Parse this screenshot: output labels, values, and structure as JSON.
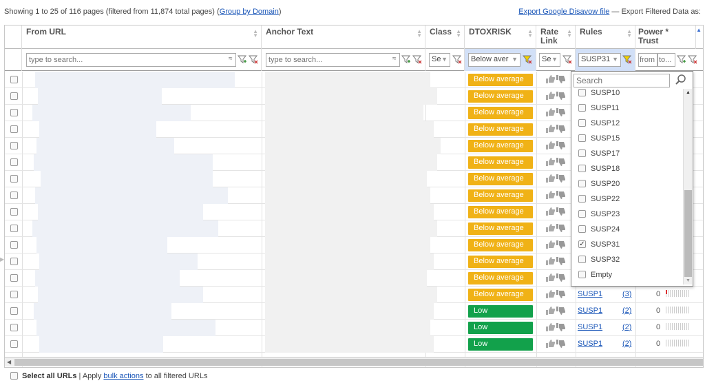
{
  "top": {
    "showing_text": "Showing 1 to 25 of 116 pages (filtered from 11,874 total pages) (",
    "group_link": "Group by Domain",
    "showing_close": ")",
    "export_link": "Export Google Disavow file",
    "export_text": " — Export Filtered Data as:"
  },
  "columns": {
    "from_url": "From URL",
    "anchor_text": "Anchor Text",
    "class": "Class",
    "dtoxrisk": "DTOXRISK",
    "rate_link": "Rate Link",
    "rules": "Rules",
    "power_trust": "Power * Trust"
  },
  "filters": {
    "from_url_placeholder": "type to search...",
    "anchor_placeholder": "type to search...",
    "class_value": "Se",
    "dtox_value": "Below aver",
    "rate_value": "Se",
    "rules_value": "SUSP31",
    "power_from": "from",
    "power_to": "to..."
  },
  "rows": [
    {
      "risk": "Below average",
      "level": "below",
      "rule": "",
      "count": "",
      "power": ""
    },
    {
      "risk": "Below average",
      "level": "below",
      "rule": "",
      "count": "",
      "power": ""
    },
    {
      "risk": "Below average",
      "level": "below",
      "rule": "",
      "count": "",
      "power": ""
    },
    {
      "risk": "Below average",
      "level": "below",
      "rule": "",
      "count": "",
      "power": ""
    },
    {
      "risk": "Below average",
      "level": "below",
      "rule": "",
      "count": "",
      "power": ""
    },
    {
      "risk": "Below average",
      "level": "below",
      "rule": "",
      "count": "",
      "power": ""
    },
    {
      "risk": "Below average",
      "level": "below",
      "rule": "",
      "count": "",
      "power": ""
    },
    {
      "risk": "Below average",
      "level": "below",
      "rule": "",
      "count": "",
      "power": ""
    },
    {
      "risk": "Below average",
      "level": "below",
      "rule": "",
      "count": "",
      "power": ""
    },
    {
      "risk": "Below average",
      "level": "below",
      "rule": "",
      "count": "",
      "power": ""
    },
    {
      "risk": "Below average",
      "level": "below",
      "rule": "",
      "count": "",
      "power": ""
    },
    {
      "risk": "Below average",
      "level": "below",
      "rule": "",
      "count": "",
      "power": ""
    },
    {
      "risk": "Below average",
      "level": "below",
      "rule": "",
      "count": "",
      "power": ""
    },
    {
      "risk": "Below average",
      "level": "below",
      "rule": "SUSP1",
      "count": "(3)",
      "power": "0"
    },
    {
      "risk": "Low",
      "level": "low",
      "rule": "SUSP1",
      "count": "(2)",
      "power": "0"
    },
    {
      "risk": "Low",
      "level": "low",
      "rule": "SUSP1",
      "count": "(2)",
      "power": "0"
    },
    {
      "risk": "Low",
      "level": "low",
      "rule": "SUSP1",
      "count": "(2)",
      "power": "0"
    }
  ],
  "rules_popup": {
    "search_placeholder": "Search",
    "items": [
      {
        "label": "SUSP10",
        "checked": false
      },
      {
        "label": "SUSP11",
        "checked": false
      },
      {
        "label": "SUSP12",
        "checked": false
      },
      {
        "label": "SUSP15",
        "checked": false
      },
      {
        "label": "SUSP17",
        "checked": false
      },
      {
        "label": "SUSP18",
        "checked": false
      },
      {
        "label": "SUSP20",
        "checked": false
      },
      {
        "label": "SUSP22",
        "checked": false
      },
      {
        "label": "SUSP23",
        "checked": false
      },
      {
        "label": "SUSP24",
        "checked": false
      },
      {
        "label": "SUSP31",
        "checked": true
      },
      {
        "label": "SUSP32",
        "checked": false
      },
      {
        "label": "Empty",
        "checked": false
      }
    ]
  },
  "footer": {
    "select_all": "Select all URLs",
    "apply_text": " | Apply ",
    "bulk_link": "bulk actions",
    "tail": " to all filtered URLs"
  },
  "colors": {
    "below": "#f0b216",
    "low": "#12a14b",
    "link": "#1a56b8"
  }
}
